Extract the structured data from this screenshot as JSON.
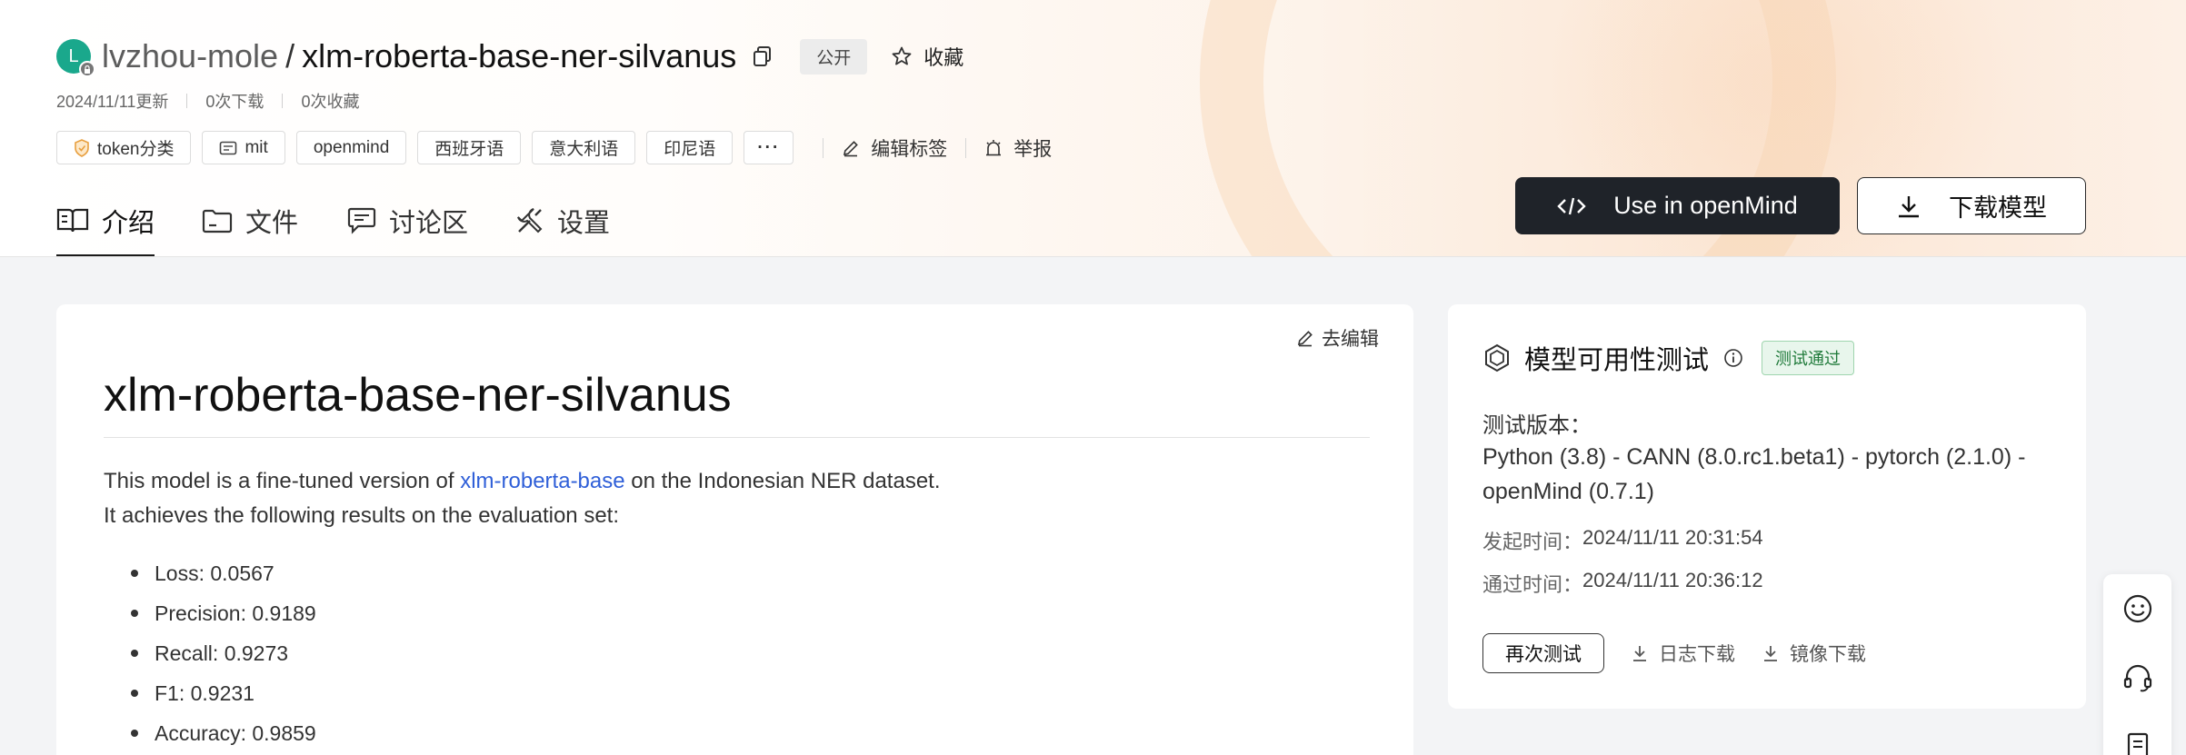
{
  "header": {
    "owner": "lvzhou-mole",
    "separator": "/",
    "repo_name": "xlm-roberta-base-ner-silvanus",
    "avatar_letter": "L",
    "visibility_badge": "公开",
    "favorite_label": "收藏",
    "updated": "2024/11/11更新",
    "downloads": "0次下载",
    "favorites": "0次收藏"
  },
  "tags": {
    "items": [
      {
        "label": "token分类",
        "icon": "task-icon"
      },
      {
        "label": "mit",
        "icon": "license-icon"
      },
      {
        "label": "openmind"
      },
      {
        "label": "西班牙语"
      },
      {
        "label": "意大利语"
      },
      {
        "label": "印尼语"
      }
    ],
    "more_label": "···",
    "edit_tags_label": "编辑标签",
    "report_label": "举报"
  },
  "tabs": [
    {
      "label": "介绍",
      "icon": "book-icon",
      "active": true
    },
    {
      "label": "文件",
      "icon": "folder-icon",
      "active": false
    },
    {
      "label": "讨论区",
      "icon": "chat-icon",
      "active": false
    },
    {
      "label": "设置",
      "icon": "tools-icon",
      "active": false
    }
  ],
  "actions": {
    "use_openmind_label": "Use in openMind",
    "download_model_label": "下载模型"
  },
  "readme": {
    "edit_label": "去编辑",
    "title": "xlm-roberta-base-ner-silvanus",
    "para1_prefix": "This model is a fine-tuned version of ",
    "para1_link": "xlm-roberta-base",
    "para1_suffix": " on the Indonesian NER dataset.",
    "para2": "It achieves the following results on the evaluation set:",
    "metrics": [
      "Loss: 0.0567",
      "Precision: 0.9189",
      "Recall: 0.9273",
      "F1: 0.9231",
      "Accuracy: 0.9859"
    ]
  },
  "availability": {
    "title": "模型可用性测试",
    "status_badge": "测试通过",
    "status_color": "#1f7a3a",
    "version_label": "测试版本：",
    "version_value": "Python (3.8) - CANN (8.0.rc1.beta1) - pytorch (2.1.0) - openMind (0.7.1)",
    "started_label": "发起时间：",
    "started_value": "2024/11/11 20:31:54",
    "passed_label": "通过时间：",
    "passed_value": "2024/11/11 20:36:12",
    "retest_label": "再次测试",
    "log_download_label": "日志下载",
    "image_download_label": "镜像下载"
  },
  "float_bar": {
    "items": [
      "smile-icon",
      "headset-icon",
      "document-icon"
    ]
  },
  "colors": {
    "primary_button": "#1f2329",
    "link": "#2f5fd8",
    "avatar": "#1aa88c"
  }
}
